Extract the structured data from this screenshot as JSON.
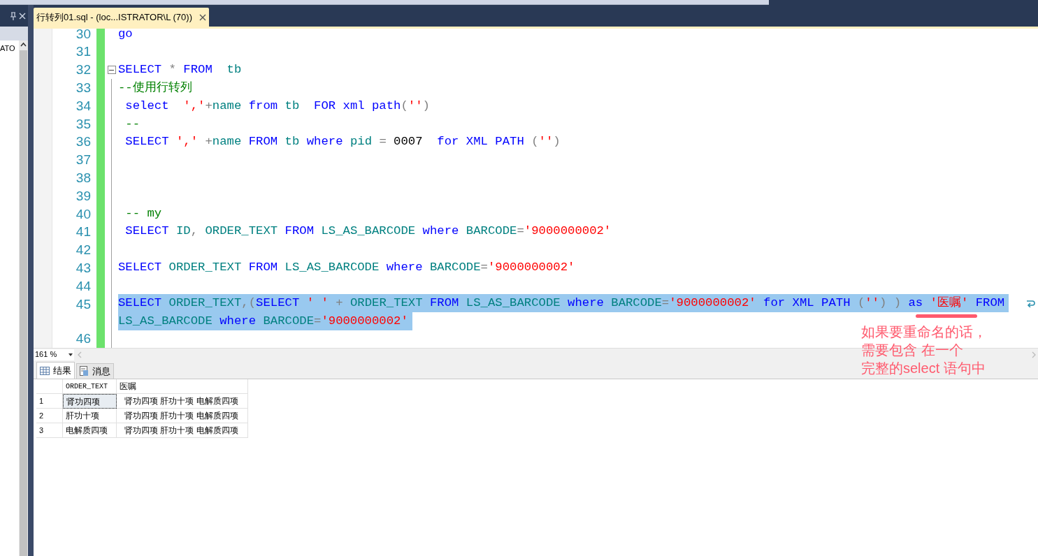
{
  "left_panel": {
    "label": "ATO"
  },
  "document_tab": {
    "title": "行转列01.sql - (loc...ISTRATOR\\L (70))",
    "selected": true
  },
  "editor": {
    "lines": [
      {
        "number": "30",
        "tokens": [
          {
            "kind": "kw",
            "text": "go"
          }
        ],
        "selected": false
      },
      {
        "number": "31",
        "selected": false
      },
      {
        "number": "32",
        "fold": {
          "expanded": true
        },
        "tokens": [
          {
            "kind": "kw",
            "text": "SELECT"
          },
          {
            "kind": "op",
            "text": " * "
          },
          {
            "kind": "kw",
            "text": "FROM"
          },
          {
            "kind": "id",
            "text": "  tb"
          }
        ],
        "selected": false
      },
      {
        "number": "33",
        "tokens": [
          {
            "kind": "cmt",
            "text": "--使用行转列"
          }
        ],
        "selected": false
      },
      {
        "number": "34",
        "tokens": [
          {
            "kind": "kw",
            "text": " select"
          },
          {
            "kind": "str",
            "text": "  ','"
          },
          {
            "kind": "op",
            "text": "+"
          },
          {
            "kind": "id",
            "text": "name "
          },
          {
            "kind": "kw",
            "text": "from"
          },
          {
            "kind": "id",
            "text": " tb  "
          },
          {
            "kind": "kw",
            "text": "FOR xml path"
          },
          {
            "kind": "op",
            "text": "("
          },
          {
            "kind": "str",
            "text": "''"
          },
          {
            "kind": "op",
            "text": ")"
          }
        ],
        "selected": false
      },
      {
        "number": "35",
        "tokens": [
          {
            "kind": "cmt",
            "text": " --"
          }
        ],
        "selected": false
      },
      {
        "number": "36",
        "tokens": [
          {
            "kind": "kw",
            "text": " SELECT"
          },
          {
            "kind": "str",
            "text": " ','"
          },
          {
            "kind": "op",
            "text": " +"
          },
          {
            "kind": "id",
            "text": "name "
          },
          {
            "kind": "kw",
            "text": "FROM"
          },
          {
            "kind": "id",
            "text": " tb "
          },
          {
            "kind": "kw",
            "text": "where"
          },
          {
            "kind": "id",
            "text": " pid "
          },
          {
            "kind": "op",
            "text": "="
          },
          {
            "kind": "num",
            "text": " 0007  "
          },
          {
            "kind": "kw",
            "text": "for XML PATH "
          },
          {
            "kind": "op",
            "text": "("
          },
          {
            "kind": "str",
            "text": "''"
          },
          {
            "kind": "op",
            "text": ")"
          }
        ],
        "selected": false
      },
      {
        "number": "37",
        "selected": false
      },
      {
        "number": "38",
        "selected": false
      },
      {
        "number": "39",
        "selected": false
      },
      {
        "number": "40",
        "tokens": [
          {
            "kind": "cmt",
            "text": " -- my"
          }
        ],
        "selected": false
      },
      {
        "number": "41",
        "tokens": [
          {
            "kind": "kw",
            "text": " SELECT"
          },
          {
            "kind": "id",
            "text": " ID"
          },
          {
            "kind": "op",
            "text": ", "
          },
          {
            "kind": "id",
            "text": "ORDER_TEXT "
          },
          {
            "kind": "kw",
            "text": "FROM"
          },
          {
            "kind": "id",
            "text": " LS_AS_BARCODE "
          },
          {
            "kind": "kw",
            "text": "where"
          },
          {
            "kind": "id",
            "text": " BARCODE"
          },
          {
            "kind": "op",
            "text": "="
          },
          {
            "kind": "str",
            "text": "'9000000002'"
          }
        ],
        "selected": false
      },
      {
        "number": "42",
        "selected": false
      },
      {
        "number": "43",
        "tokens": [
          {
            "kind": "kw",
            "text": "SELECT"
          },
          {
            "kind": "id",
            "text": " ORDER_TEXT "
          },
          {
            "kind": "kw",
            "text": "FROM"
          },
          {
            "kind": "id",
            "text": " LS_AS_BARCODE "
          },
          {
            "kind": "kw",
            "text": "where"
          },
          {
            "kind": "id",
            "text": " BARCODE"
          },
          {
            "kind": "op",
            "text": "="
          },
          {
            "kind": "str",
            "text": "'9000000002'"
          }
        ],
        "selected": false
      },
      {
        "number": "44",
        "selected": false
      },
      {
        "number": "45",
        "tokens": [
          {
            "kind": "kw",
            "text": "SELECT"
          },
          {
            "kind": "id",
            "text": " ORDER_TEXT"
          },
          {
            "kind": "op",
            "text": ",("
          },
          {
            "kind": "kw",
            "text": "SELECT"
          },
          {
            "kind": "str",
            "text": " ' '"
          },
          {
            "kind": "op",
            "text": " + "
          },
          {
            "kind": "id",
            "text": "ORDER_TEXT "
          },
          {
            "kind": "kw",
            "text": "FROM"
          },
          {
            "kind": "id",
            "text": " LS_AS_BARCODE "
          },
          {
            "kind": "kw",
            "text": "where"
          },
          {
            "kind": "id",
            "text": " BARCODE"
          },
          {
            "kind": "op",
            "text": "="
          },
          {
            "kind": "str",
            "text": "'9000000002'"
          },
          {
            "kind": "kw",
            "text": " for XML PATH "
          },
          {
            "kind": "op",
            "text": "("
          },
          {
            "kind": "str",
            "text": "''"
          },
          {
            "kind": "op",
            "text": ") ) "
          },
          {
            "kind": "kw",
            "text": "as"
          },
          {
            "kind": "str",
            "text": " '医嘱'"
          },
          {
            "kind": "kw",
            "text": " FROM"
          },
          {
            "kind": "id",
            "text": "LS_AS_BARCODE ",
            "wrap": true
          },
          {
            "kind": "kw",
            "text": "where"
          },
          {
            "kind": "id",
            "text": " BARCODE"
          },
          {
            "kind": "op",
            "text": "="
          },
          {
            "kind": "str",
            "text": "'9000000002'"
          }
        ],
        "selected": true
      },
      {
        "number": "46",
        "selected": false
      }
    ]
  },
  "zoom": {
    "value": "161 %"
  },
  "result_tabs": [
    {
      "label": "结果",
      "kind": "grid",
      "selected": true
    },
    {
      "label": "消息",
      "kind": "messages",
      "selected": false
    }
  ],
  "results": {
    "columns": [
      "ORDER_TEXT",
      "医嘱"
    ],
    "rows": [
      {
        "number": "1",
        "cells": [
          "肾功四项",
          "肾功四项 肝功十项 电解质四项"
        ],
        "selected": true
      },
      {
        "number": "2",
        "cells": [
          "肝功十项",
          "肾功四项 肝功十项 电解质四项"
        ],
        "selected": false
      },
      {
        "number": "3",
        "cells": [
          "电解质四项",
          "肾功四项 肝功十项 电解质四项"
        ],
        "selected": false
      }
    ]
  },
  "annotation": {
    "lines": [
      "如果要重命名的话，",
      "需要包含 在一个",
      "完整的select 语句中"
    ]
  }
}
